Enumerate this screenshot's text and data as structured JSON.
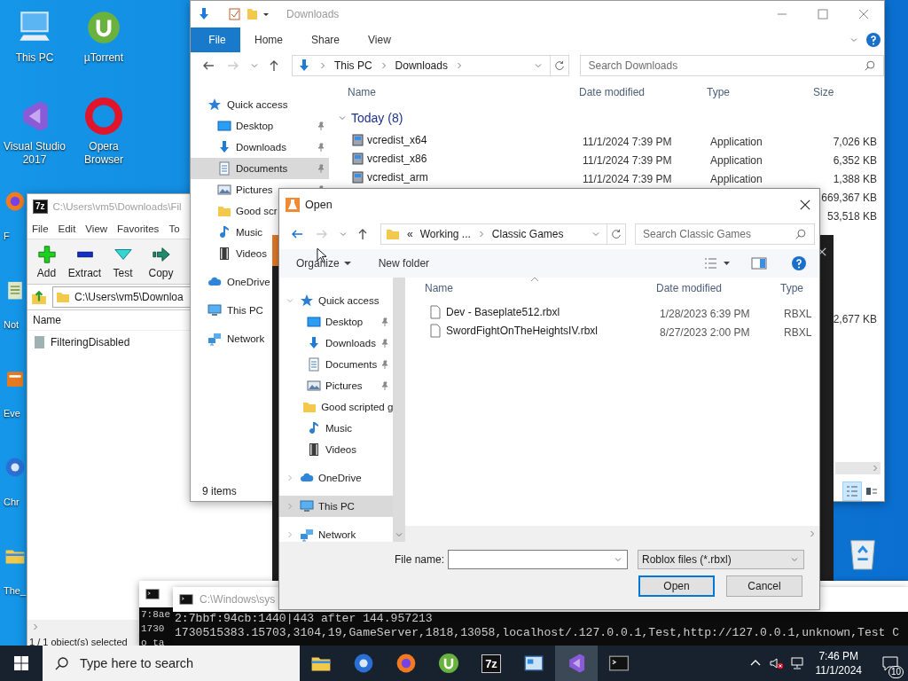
{
  "desktop": {
    "icons": [
      {
        "label": "This PC",
        "kind": "pc"
      },
      {
        "label": "µTorrent",
        "kind": "torrent"
      },
      {
        "label": "Visual Studio 2017",
        "kind": "studio"
      },
      {
        "label": "Opera Browser",
        "kind": "opera"
      }
    ],
    "covered_icons": [
      {
        "label": "F",
        "kind": "fox"
      },
      {
        "label": "Not",
        "kind": "notepad"
      },
      {
        "label": "Eve",
        "kind": "app"
      },
      {
        "label": "Chr",
        "kind": "chrome"
      },
      {
        "label": "The_",
        "kind": "folder"
      }
    ]
  },
  "archiver": {
    "logo": "7z",
    "title": "C:\\Users\\vm5\\Downloads\\Fil",
    "menu": [
      "File",
      "Edit",
      "View",
      "Favorites",
      "To"
    ],
    "tools": [
      {
        "label": "Add",
        "kind": "add"
      },
      {
        "label": "Extract",
        "kind": "extract"
      },
      {
        "label": "Test",
        "kind": "test"
      },
      {
        "label": "Copy",
        "kind": "copy"
      }
    ],
    "path": "C:\\Users\\vm5\\Downloa",
    "columns": [
      "Name"
    ],
    "rows": [
      {
        "name": "FilteringDisabled"
      }
    ],
    "status": "1 / 1 object(s) selected"
  },
  "explorer": {
    "title": "Downloads",
    "tabs": [
      {
        "label": "File",
        "kind": "file"
      },
      {
        "label": "Home",
        "kind": "tab"
      },
      {
        "label": "Share",
        "kind": "tab"
      },
      {
        "label": "View",
        "kind": "tab"
      }
    ],
    "path": [
      "This PC",
      "Downloads"
    ],
    "search": {
      "placeholder": "Search Downloads"
    },
    "sidebar": [
      {
        "label": "Quick access",
        "kind": "star",
        "selected": false,
        "children": [
          {
            "label": "Desktop",
            "kind": "desktop",
            "pinned": true,
            "selected": false
          },
          {
            "label": "Downloads",
            "kind": "downloads",
            "pinned": true,
            "selected": false
          },
          {
            "label": "Documents",
            "kind": "documents",
            "pinned": true,
            "selected": true
          },
          {
            "label": "Pictures",
            "kind": "pictures",
            "pinned": true,
            "selected": false
          },
          {
            "label": "Good scr",
            "kind": "folder",
            "selected": false
          },
          {
            "label": "Music",
            "kind": "music",
            "selected": false
          },
          {
            "label": "Videos",
            "kind": "videos",
            "selected": false
          }
        ]
      },
      {
        "label": "OneDrive",
        "kind": "cloud",
        "selected": false
      },
      {
        "label": "This PC",
        "kind": "pc",
        "selected": false
      },
      {
        "label": "Network",
        "kind": "network",
        "selected": false
      }
    ],
    "columns": [
      "Name",
      "Date modified",
      "Type",
      "Size"
    ],
    "groups": [
      {
        "label": "Today (8)",
        "expanded": true,
        "rows": [
          {
            "name": "vcredist_x64",
            "date": "11/1/2024 7:39 PM",
            "type": "Application",
            "size": "7,026 KB"
          },
          {
            "name": "vcredist_x86",
            "date": "11/1/2024 7:39 PM",
            "type": "Application",
            "size": "6,352 KB"
          },
          {
            "name": "vcredist_arm",
            "date": "11/1/2024 7:39 PM",
            "type": "Application",
            "size": "1,388 KB"
          },
          {
            "size": "669,367 KB"
          },
          {
            "size": "53,518 KB"
          }
        ]
      },
      {
        "rows": [
          {
            "size": "2,677 KB"
          }
        ]
      }
    ],
    "status": "9 items"
  },
  "consoles": [
    {
      "lines": [
        "7:8ae",
        "1730",
        "o ta"
      ]
    },
    {
      "title": "C:\\Windows\\sys",
      "lines": [
        "2:7bbf:94cb:1440|443 after 144.957213",
        "1730515383.15703,3104,19,GameServer,1818,13058,localhost/.127.0.0.1,Test,http://127.0.0.1,unknown,Test C"
      ]
    }
  ],
  "dialog": {
    "title": "Open",
    "overflow": "«",
    "path": [
      "Working ...",
      "Classic Games"
    ],
    "search": {
      "placeholder": "Search Classic Games"
    },
    "commands": [
      {
        "label": "Organize",
        "menu": true
      },
      {
        "label": "New folder",
        "menu": false
      }
    ],
    "sidebar": [
      {
        "label": "Quick access",
        "kind": "star",
        "expanded": true,
        "selected": false,
        "children": [
          {
            "label": "Desktop",
            "kind": "desktop",
            "pinned": true,
            "selected": false
          },
          {
            "label": "Downloads",
            "kind": "downloads",
            "pinned": true,
            "selected": false
          },
          {
            "label": "Documents",
            "kind": "documents",
            "pinned": true,
            "selected": false
          },
          {
            "label": "Pictures",
            "kind": "pictures",
            "pinned": true,
            "selected": false
          },
          {
            "label": "Good scripted g",
            "kind": "folder",
            "pinned": false,
            "selected": false
          },
          {
            "label": "Music",
            "kind": "music",
            "pinned": false,
            "selected": false
          },
          {
            "label": "Videos",
            "kind": "videos",
            "pinned": false,
            "selected": false
          }
        ]
      },
      {
        "label": "OneDrive",
        "kind": "cloud",
        "expanded": false,
        "selected": false
      },
      {
        "label": "This PC",
        "kind": "pc",
        "expanded": false,
        "selected": true
      },
      {
        "label": "Network",
        "kind": "network",
        "expanded": false,
        "selected": false
      }
    ],
    "columns": [
      "Name",
      "Date modified",
      "Type"
    ],
    "files": [
      {
        "name": "Dev - Baseplate512.rbxl",
        "date": "1/28/2023 6:39 PM",
        "type": "RBXL"
      },
      {
        "name": "SwordFightOnTheHeightsIV.rbxl",
        "date": "8/27/2023 2:00 PM",
        "type": "RBXL"
      }
    ],
    "file_name_label": "File name:",
    "filter": "Roblox files (*.rbxl)",
    "buttons": [
      {
        "label": "Open",
        "default": true
      },
      {
        "label": "Cancel",
        "default": false
      }
    ]
  },
  "taskbar": {
    "search": {
      "placeholder": "Type here to search"
    },
    "apps": [
      {
        "kind": "explorer",
        "active": false
      },
      {
        "kind": "chrome",
        "active": false
      },
      {
        "kind": "fox",
        "active": false
      },
      {
        "kind": "torrent",
        "active": false
      },
      {
        "kind": "archiver",
        "logo": "7z",
        "active": false
      },
      {
        "kind": "panel",
        "active": false
      },
      {
        "kind": "studio",
        "active": true
      },
      {
        "kind": "console",
        "active": false
      }
    ],
    "clock": {
      "time": "7:46 PM",
      "date": "11/1/2024"
    },
    "notifications": "10"
  }
}
